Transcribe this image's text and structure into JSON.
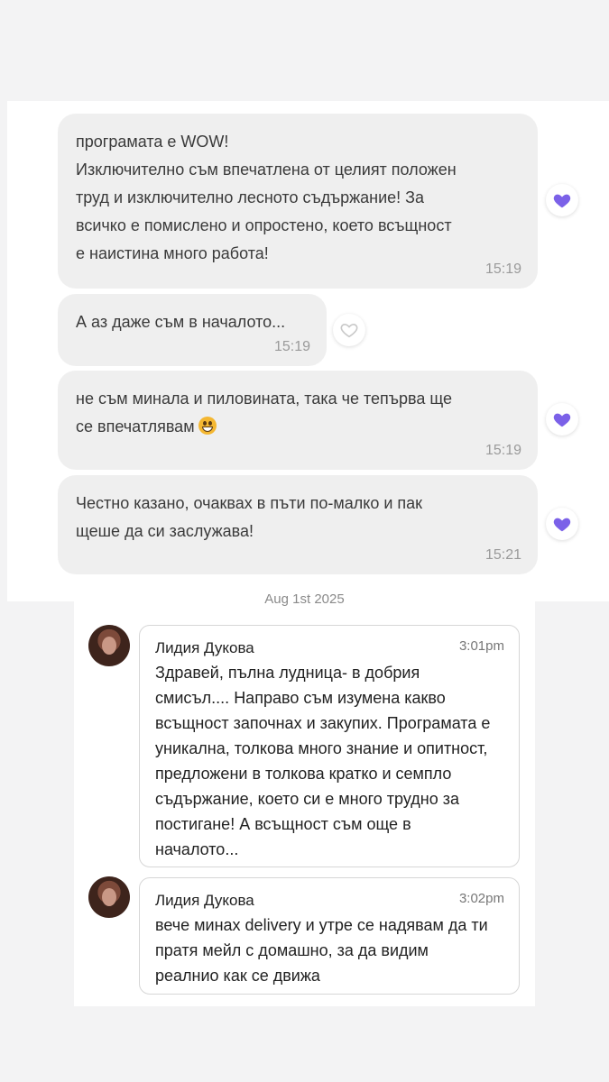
{
  "messages": [
    {
      "text": "програмата е WOW!\nИзключително съм впечатлена от целият положен\nтруд и изключително лесното съдържание! За\nвсичко е помислено и опростено, което всъщност\nе наистина много работа!",
      "time": "15:19",
      "liked": true
    },
    {
      "text": "А аз даже съм в началото...",
      "time": "15:19",
      "liked": false
    },
    {
      "text": "не съм минала и пиловината, така че тепърва ще\nсе впечатлявам",
      "time": "15:19",
      "liked": true
    },
    {
      "text": "Честно казано, очаквах в пъти по-малко и пак\nщеше да си заслужава!",
      "time": "15:21",
      "liked": true
    }
  ],
  "icons": {
    "liked": "heart-filled-icon",
    "unliked": "heart-outline-icon",
    "emoji": "grinning-emoji-icon"
  },
  "colors": {
    "bubble": "#efefef",
    "heart": "#7b61e8",
    "background": "#f3f3f4"
  },
  "date_separator": "Aug 1st 2025",
  "comments": [
    {
      "author": "Лидия Дукова",
      "time": "3:01pm",
      "text": "Здравей, пълна лудница- в добрия\nсмисъл.... Направо съм изумена какво\nвсъщност започнах и закупих. Програмата е\nуникална, толкова много знание и опитност,\nпредложени в толкова кратко и семпло\nсъдържание, което си е много трудно за\nпостигане! А всъщност съм още в\nначалото..."
    },
    {
      "author": "Лидия Дукова",
      "time": "3:02pm",
      "text": "вече минах delivery и утре се надявам да ти\nпратя мейл с домашно, за да видим\nреалнио как се движа"
    }
  ]
}
